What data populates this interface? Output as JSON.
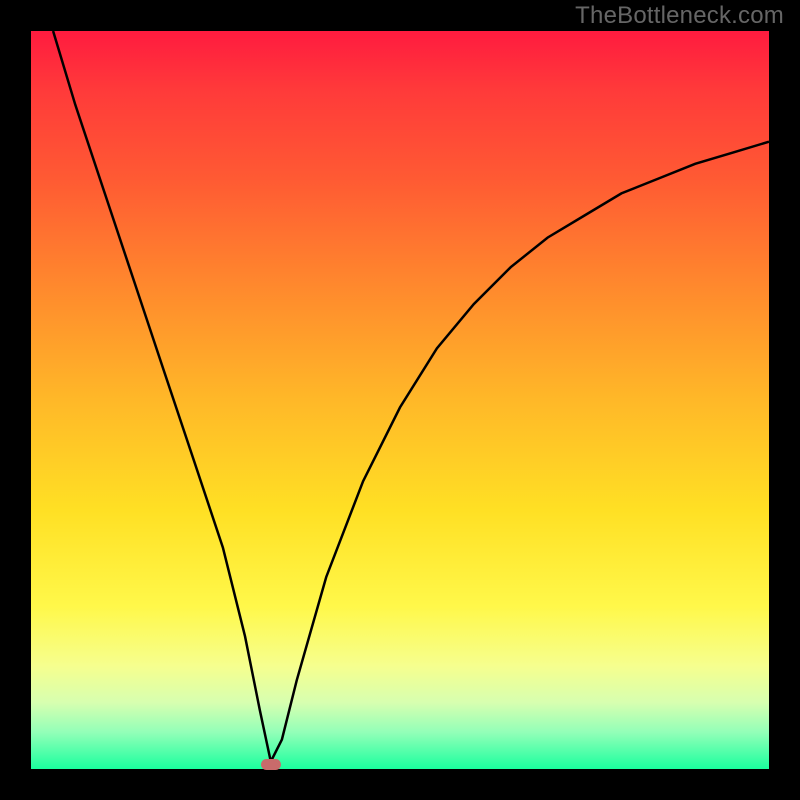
{
  "watermark": "TheBottleneck.com",
  "chart_data": {
    "type": "line",
    "title": "",
    "xlabel": "",
    "ylabel": "",
    "xlim": [
      0,
      100
    ],
    "ylim": [
      0,
      100
    ],
    "grid": false,
    "legend": false,
    "series": [
      {
        "name": "curve",
        "x": [
          3,
          6,
          10,
          14,
          18,
          22,
          26,
          29,
          31,
          32.5,
          34,
          36,
          40,
          45,
          50,
          55,
          60,
          65,
          70,
          75,
          80,
          85,
          90,
          95,
          100
        ],
        "values": [
          100,
          90,
          78,
          66,
          54,
          42,
          30,
          18,
          8,
          1,
          4,
          12,
          26,
          39,
          49,
          57,
          63,
          68,
          72,
          75,
          78,
          80,
          82,
          83.5,
          85
        ]
      }
    ],
    "marker": {
      "x": 32.5,
      "y": 0.7
    }
  },
  "colors": {
    "curve": "#000000",
    "marker": "#c96b6b",
    "background_frame": "#000000",
    "watermark": "#666666"
  }
}
